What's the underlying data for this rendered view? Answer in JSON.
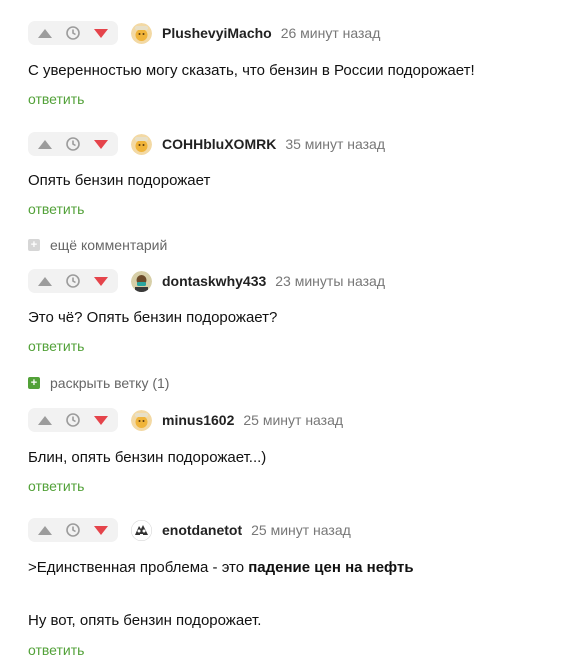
{
  "comments": [
    {
      "author": "PlushevyiMacho",
      "time": "26 минут назад",
      "text": "С уверенностью могу сказать, что бензин в России подорожает!",
      "reply": "ответить"
    },
    {
      "author": "COHHbluXOMRK",
      "time": "35 минут назад",
      "text": "Опять бензин подорожает",
      "reply": "ответить"
    },
    {
      "author": "dontaskwhy433",
      "time": "23 минуты назад",
      "text": "Это чё? Опять бензин подорожает?",
      "reply": "ответить"
    },
    {
      "author": "minus1602",
      "time": "25 минут назад",
      "text": "Блин, опять бензин подорожает...)",
      "reply": "ответить"
    },
    {
      "author": "enotdanetot",
      "time": "25 минут назад",
      "text_quote_prefix": ">Единственная проблема - это ",
      "text_quote_bold": "падение цен на нефть",
      "text_line2": "Ну вот, опять бензин подорожает.",
      "reply": "ответить"
    }
  ],
  "more_comments": {
    "label": "ещё комментарий",
    "icon": "plus-icon",
    "color": "#cfcfcf"
  },
  "expand_thread": {
    "label": "раскрыть ветку (1)",
    "icon": "plus-icon",
    "color": "#52a138"
  },
  "colors": {
    "upvote": "#9c9c9c",
    "downvote": "#e5444b",
    "reply": "#52a138",
    "vote_bg": "#f2f2f2"
  }
}
